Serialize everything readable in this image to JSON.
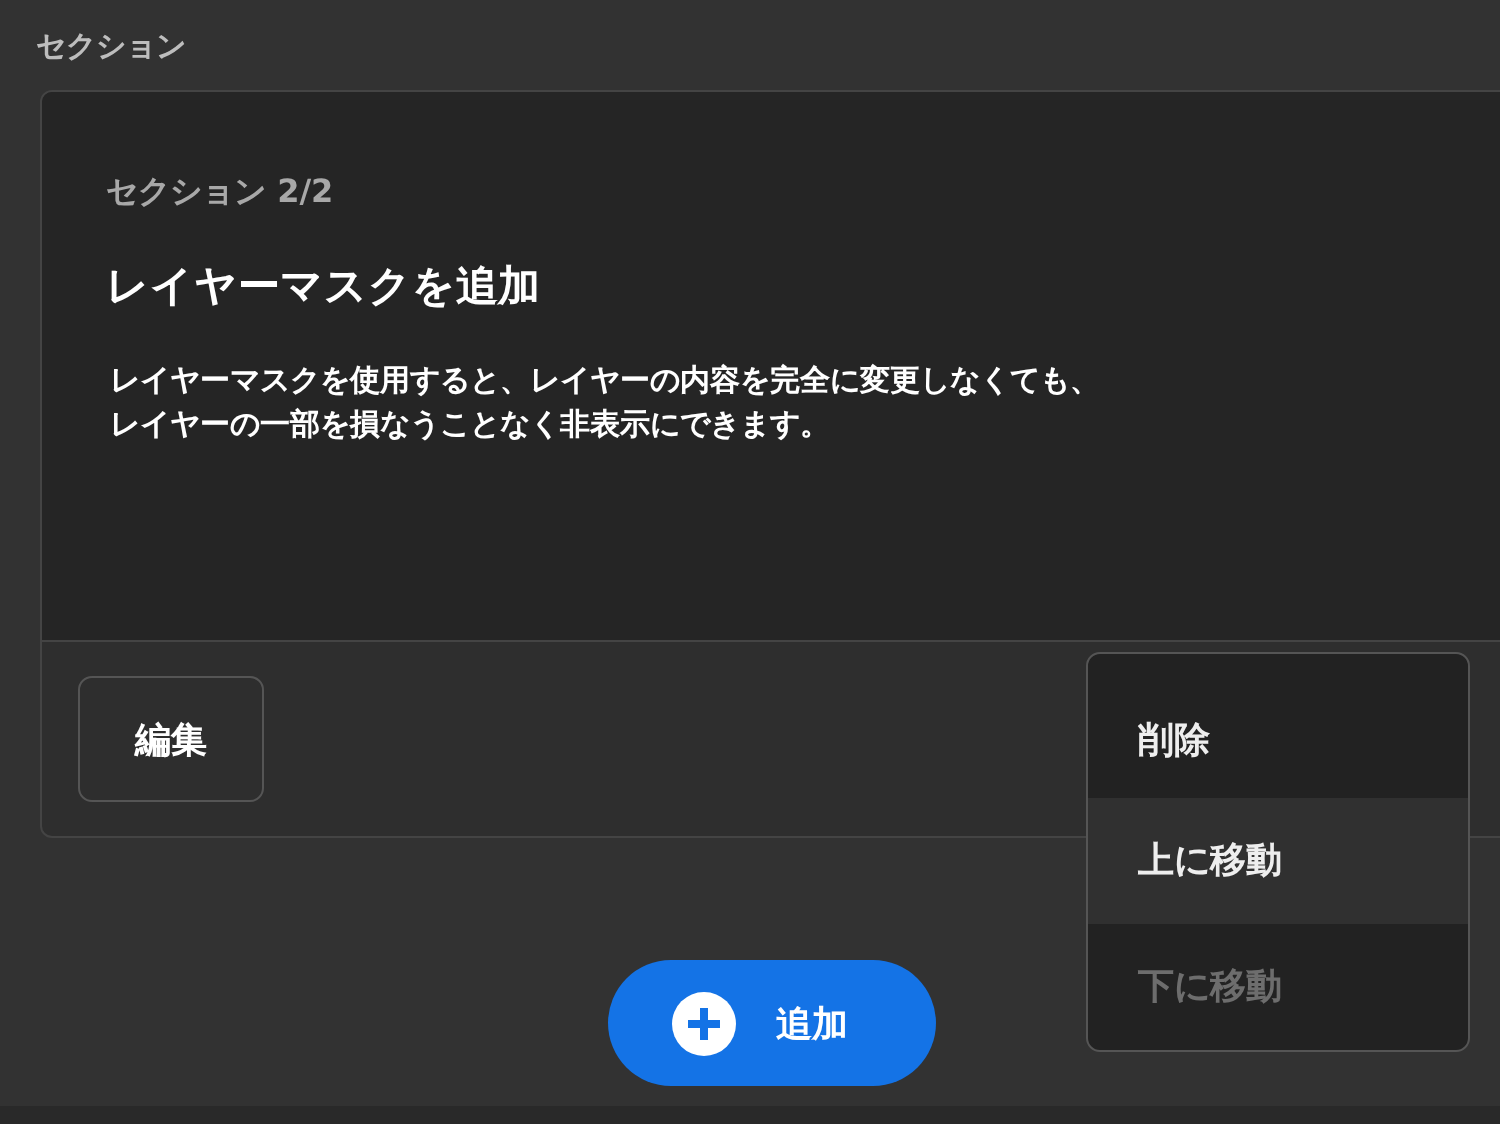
{
  "heading": "セクション",
  "card": {
    "counter": "セクション 2/2",
    "title": "レイヤーマスクを追加",
    "body_lines": [
      "レイヤーマスクを使用すると、レイヤーの内容を完全に変更しなくても、",
      "レイヤーの一部を損なうことなく非表示にできます。"
    ],
    "edit_button": "編集"
  },
  "menu": {
    "items": [
      {
        "label": "削除",
        "highlighted": false,
        "disabled": false
      },
      {
        "label": "上に移動",
        "highlighted": true,
        "disabled": false
      },
      {
        "label": "下に移動",
        "highlighted": false,
        "disabled": true
      }
    ]
  },
  "add_button": "追加"
}
